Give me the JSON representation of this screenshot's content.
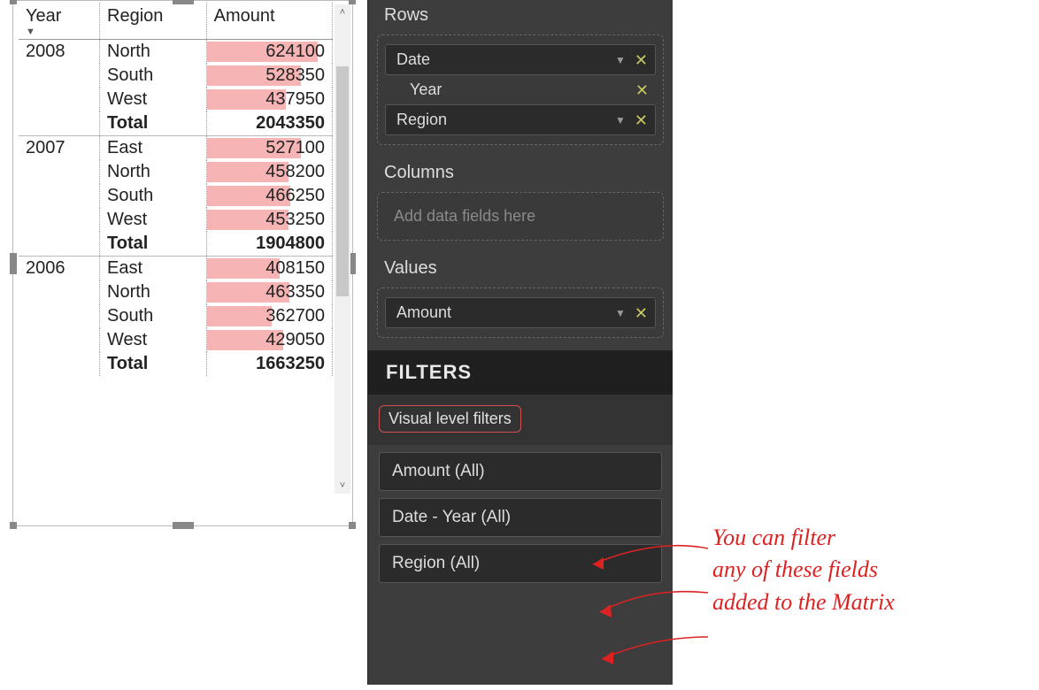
{
  "matrix": {
    "headers": {
      "year": "Year",
      "region": "Region",
      "amount": "Amount"
    },
    "max_amount": 700000,
    "groups": [
      {
        "year": "2008",
        "rows": [
          {
            "region": "North",
            "amount": 624100
          },
          {
            "region": "South",
            "amount": 528350
          },
          {
            "region": "West",
            "amount": 437950
          }
        ],
        "total_label": "Total",
        "total": 2043350
      },
      {
        "year": "2007",
        "rows": [
          {
            "region": "East",
            "amount": 527100
          },
          {
            "region": "North",
            "amount": 458200
          },
          {
            "region": "South",
            "amount": 466250
          },
          {
            "region": "West",
            "amount": 453250
          }
        ],
        "total_label": "Total",
        "total": 1904800
      },
      {
        "year": "2006",
        "rows": [
          {
            "region": "East",
            "amount": 408150
          },
          {
            "region": "North",
            "amount": 463350
          },
          {
            "region": "South",
            "amount": 362700
          },
          {
            "region": "West",
            "amount": 429050
          }
        ],
        "total_label": "Total",
        "total": 1663250
      }
    ]
  },
  "panel": {
    "rows_label": "Rows",
    "row_fields": {
      "date": "Date",
      "date_child": "Year",
      "region": "Region"
    },
    "columns_label": "Columns",
    "columns_placeholder": "Add data fields here",
    "values_label": "Values",
    "value_field": "Amount",
    "filters_header": "FILTERS",
    "vlf_label": "Visual level filters",
    "filters": [
      "Amount  (All)",
      "Date - Year  (All)",
      "Region  (All)"
    ]
  },
  "annotation": {
    "line1": "You can filter",
    "line2": "any of these fields",
    "line3": "added to the Matrix"
  }
}
